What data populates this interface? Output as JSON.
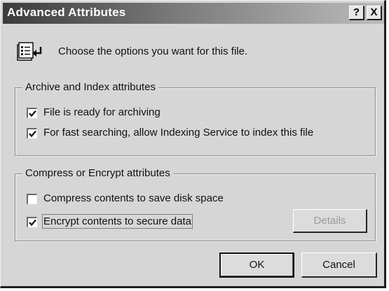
{
  "window": {
    "title": "Advanced Attributes",
    "help_label": "?",
    "close_label": "X"
  },
  "header": {
    "icon": "attributes-icon",
    "text": "Choose the options you want for this file."
  },
  "archive_group": {
    "title": "Archive and Index attributes",
    "items": [
      {
        "label": "File is ready for archiving",
        "checked": true
      },
      {
        "label": "For fast searching, allow Indexing Service to index this file",
        "checked": true
      }
    ]
  },
  "compress_group": {
    "title": "Compress or Encrypt attributes",
    "items": [
      {
        "label": "Compress contents to save disk space",
        "checked": false
      },
      {
        "label": "Encrypt contents to secure data",
        "checked": true
      }
    ],
    "details_label": "Details",
    "details_enabled": false
  },
  "buttons": {
    "ok_label": "OK",
    "cancel_label": "Cancel"
  },
  "colors": {
    "dialog_bg": "#d6d6d6",
    "titlebar_start": "#3b3b3b",
    "titlebar_end": "#bcbcbc",
    "disabled_text": "#9a9a9a"
  }
}
